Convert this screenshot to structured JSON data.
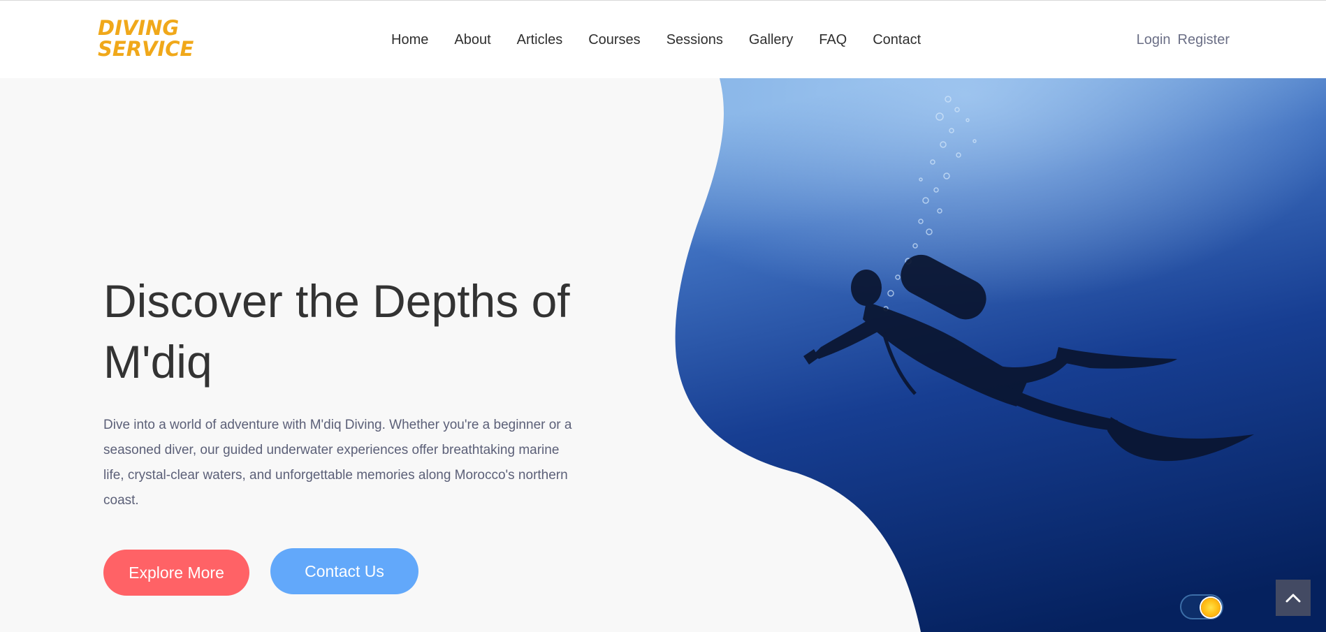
{
  "logo": {
    "line1": "DIVING",
    "line2": "SERVICE",
    "color": "#f0a81a"
  },
  "nav": {
    "items": [
      {
        "label": "Home"
      },
      {
        "label": "About"
      },
      {
        "label": "Articles"
      },
      {
        "label": "Courses"
      },
      {
        "label": "Sessions"
      },
      {
        "label": "Gallery"
      },
      {
        "label": "FAQ"
      },
      {
        "label": "Contact"
      }
    ]
  },
  "auth": {
    "login": "Login",
    "register": "Register"
  },
  "hero": {
    "title": "Discover the Depths of M'diq",
    "description": "Dive into a world of adventure with M'diq Diving. Whether you're a beginner or a seasoned diver, our guided underwater experiences offer breathtaking marine life, crystal-clear waters, and unforgettable memories along Morocco's northern coast.",
    "image_icon": "scuba-diver-photo"
  },
  "buttons": {
    "explore": "Explore More",
    "contact": "Contact Us"
  },
  "colors": {
    "accent_red": "#ff6266",
    "accent_blue": "#62a8fa",
    "ocean_deep": "#08296b",
    "ocean_light": "#6a9fdc",
    "text_dark": "#333333"
  },
  "controls": {
    "theme_toggle_icon": "sun-icon",
    "scroll_top_icon": "chevron-up-icon"
  }
}
